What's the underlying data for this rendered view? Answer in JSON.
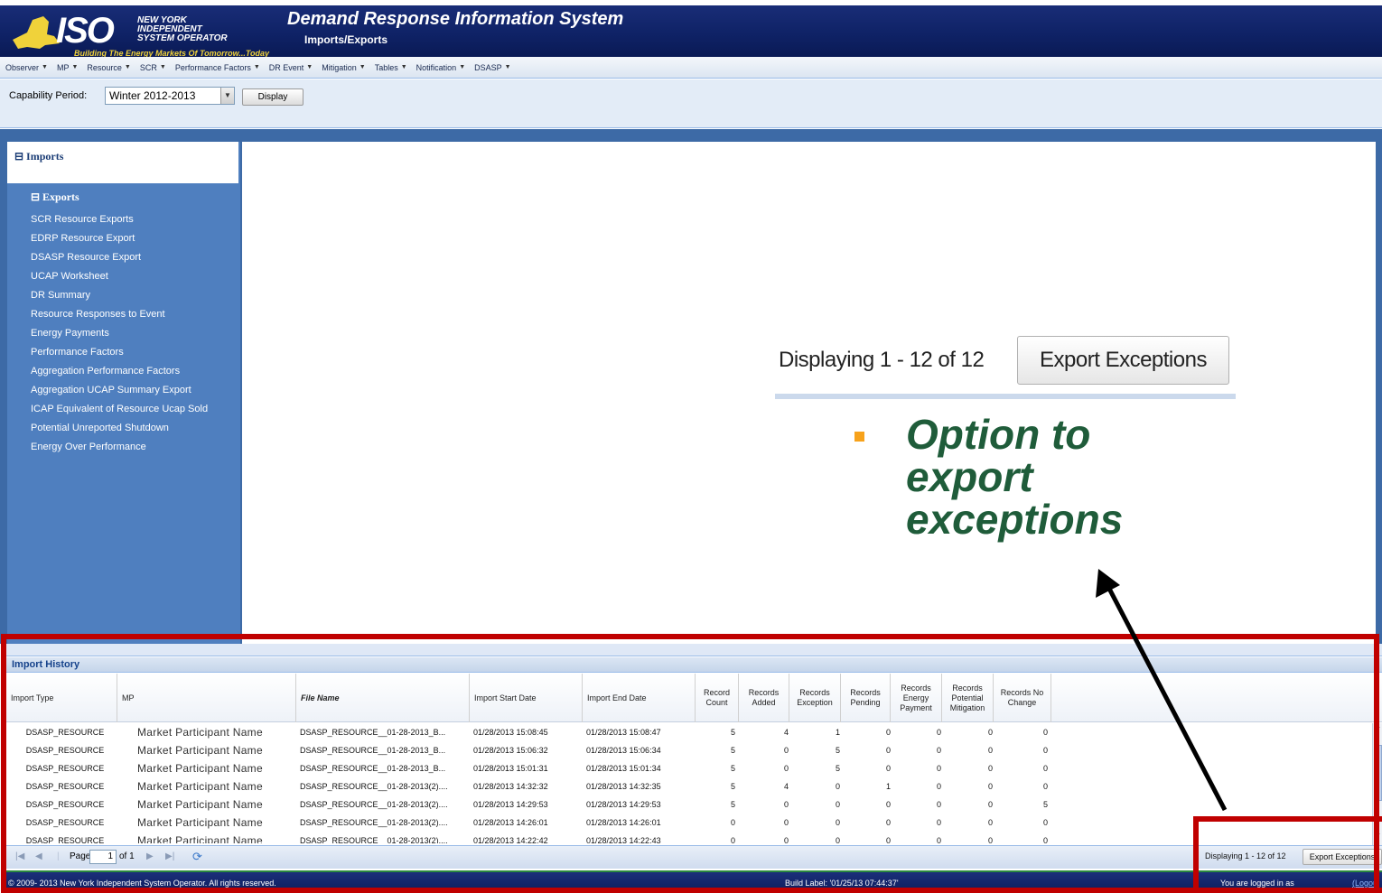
{
  "header": {
    "logo_iso": "ISO",
    "logo_org_line1": "NEW YORK",
    "logo_org_line2": "INDEPENDENT",
    "logo_org_line3": "SYSTEM OPERATOR",
    "logo_tagline": "Building The Energy Markets Of Tomorrow...Today",
    "app_title": "Demand Response Information System",
    "page_subtitle": "Imports/Exports"
  },
  "menu": [
    {
      "label": "Observer"
    },
    {
      "label": "MP"
    },
    {
      "label": "Resource"
    },
    {
      "label": "SCR"
    },
    {
      "label": "Performance Factors"
    },
    {
      "label": "DR Event"
    },
    {
      "label": "Mitigation"
    },
    {
      "label": "Tables"
    },
    {
      "label": "Notification"
    },
    {
      "label": "DSASP"
    }
  ],
  "capability": {
    "label": "Capability Period:",
    "selected": "Winter 2012-2013",
    "display_button": "Display"
  },
  "sidebar": {
    "imports_header": "⊟ Imports",
    "exports_header": "⊟ Exports",
    "export_links": [
      "SCR Resource Exports",
      "EDRP Resource Export",
      "DSASP Resource Export",
      "UCAP Worksheet",
      "DR Summary",
      "Resource Responses to Event",
      "Energy Payments",
      "Performance Factors",
      "Aggregation Performance Factors",
      "Aggregation UCAP Summary Export",
      "ICAP Equivalent of Resource Ucap Sold",
      "Potential Unreported Shutdown",
      "Energy Over Performance"
    ]
  },
  "callout": {
    "zoom_displaying": "Displaying 1 - 12 of 12",
    "zoom_export_button": "Export Exceptions",
    "text": "Option to export exceptions",
    "colors": {
      "text": "#1f5c3a",
      "bullet": "#f7a21b",
      "highlight_border": "#c00000"
    }
  },
  "history": {
    "title": "Import History",
    "columns": [
      "Import Type",
      "MP",
      "File Name",
      "Import Start Date",
      "Import End Date",
      "Record Count",
      "Records Added",
      "Records Exception",
      "Records Pending",
      "Records Energy Payment",
      "Records Potential Mitigation",
      "Records No Change"
    ],
    "rows": [
      [
        "DSASP_RESOURCE",
        "Market Participant Name",
        "DSASP_RESOURCE__01-28-2013_B...",
        "01/28/2013 15:08:45",
        "01/28/2013 15:08:47",
        "5",
        "4",
        "1",
        "0",
        "0",
        "0",
        "0"
      ],
      [
        "DSASP_RESOURCE",
        "Market Participant Name",
        "DSASP_RESOURCE__01-28-2013_B...",
        "01/28/2013 15:06:32",
        "01/28/2013 15:06:34",
        "5",
        "0",
        "5",
        "0",
        "0",
        "0",
        "0"
      ],
      [
        "DSASP_RESOURCE",
        "Market Participant Name",
        "DSASP_RESOURCE__01-28-2013_B...",
        "01/28/2013 15:01:31",
        "01/28/2013 15:01:34",
        "5",
        "0",
        "5",
        "0",
        "0",
        "0",
        "0"
      ],
      [
        "DSASP_RESOURCE",
        "Market Participant Name",
        "DSASP_RESOURCE__01-28-2013(2)....",
        "01/28/2013 14:32:32",
        "01/28/2013 14:32:35",
        "5",
        "4",
        "0",
        "1",
        "0",
        "0",
        "0"
      ],
      [
        "DSASP_RESOURCE",
        "Market Participant Name",
        "DSASP_RESOURCE__01-28-2013(2)....",
        "01/28/2013 14:29:53",
        "01/28/2013 14:29:53",
        "5",
        "0",
        "0",
        "0",
        "0",
        "0",
        "5"
      ],
      [
        "DSASP_RESOURCE",
        "Market Participant Name",
        "DSASP_RESOURCE__01-28-2013(2)....",
        "01/28/2013 14:26:01",
        "01/28/2013 14:26:01",
        "0",
        "0",
        "0",
        "0",
        "0",
        "0",
        "0"
      ],
      [
        "DSASP_RESOURCE",
        "Market Participant Name",
        "DSASP_RESOURCE__01-28-2013(2)....",
        "01/28/2013 14:22:42",
        "01/28/2013 14:22:43",
        "0",
        "0",
        "0",
        "0",
        "0",
        "0",
        "0"
      ]
    ],
    "pager": {
      "page_label": "Page",
      "page_value": "1",
      "of_label": "of 1",
      "displaying": "Displaying 1 - 12 of 12",
      "export_button": "Export Exceptions"
    }
  },
  "footer": {
    "copyright": "© 2009- 2013 New York Independent System Operator. All rights reserved.",
    "build_label": "Build Label: '01/25/13 07:44:37'",
    "logged_in": "You are logged in as",
    "logout": "(Logou"
  }
}
